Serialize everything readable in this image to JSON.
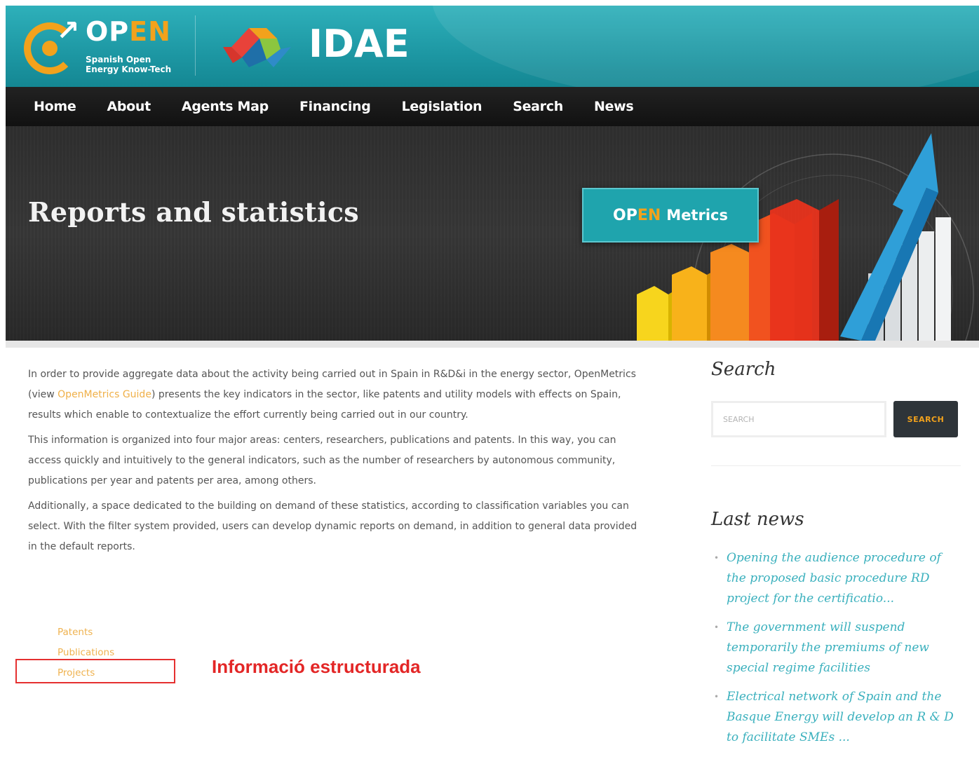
{
  "header": {
    "open_logo": {
      "word_op": "OP",
      "word_en": "EN",
      "subtitle_line1": "Spanish Open",
      "subtitle_line2": "Energy Know-Tech"
    },
    "idae_logo": {
      "word": "IDAE"
    }
  },
  "nav": {
    "items": [
      "Home",
      "About",
      "Agents Map",
      "Financing",
      "Legislation",
      "Search",
      "News"
    ]
  },
  "banner": {
    "title": "Reports and statistics",
    "badge": {
      "op": "OP",
      "en": "EN",
      "metrics": "Metrics"
    }
  },
  "main": {
    "p1_before": "In order to provide aggregate data about the activity being carried out in Spain in R&D&i in the energy sector, OpenMetrics (view ",
    "p1_link": "OpenMetrics Guide",
    "p1_after": ") presents the key indicators in the sector, like patents and utility models with effects on Spain, results which enable to contextualize the effort currently being carried out in our country.",
    "p2": "This information is organized into four major areas: centers, researchers, publications and patents. In this way, you can access quickly and intuitively to the general indicators, such as the number of researchers by autonomous community, publications per year and patents per area, among others.",
    "p3": "Additionally, a space dedicated to the building on demand of these statistics, according to classification variables you can select. With the filter system provided, users can develop dynamic reports on demand, in addition to general data provided in the default reports.",
    "links": [
      "Patents",
      "Publications",
      "Projects"
    ],
    "annotation": "Informació estructurada"
  },
  "sidebar": {
    "search_title": "Search",
    "search_placeholder": "SEARCH",
    "search_button": "SEARCH",
    "news_title": "Last news",
    "news": [
      "Opening the audience procedure of the proposed basic procedure RD project for the certificatio...",
      "The government will suspend temporarily the premiums of new special regime facilities",
      "Electrical network of Spain and the Basque Energy will develop an R & D to facilitate SMEs ..."
    ]
  },
  "colors": {
    "header_teal": "#1d97a3",
    "accent_orange": "#f2a21c",
    "nav_black": "#111111",
    "link_teal": "#3ab0bd",
    "annotation_red": "#e32626"
  }
}
